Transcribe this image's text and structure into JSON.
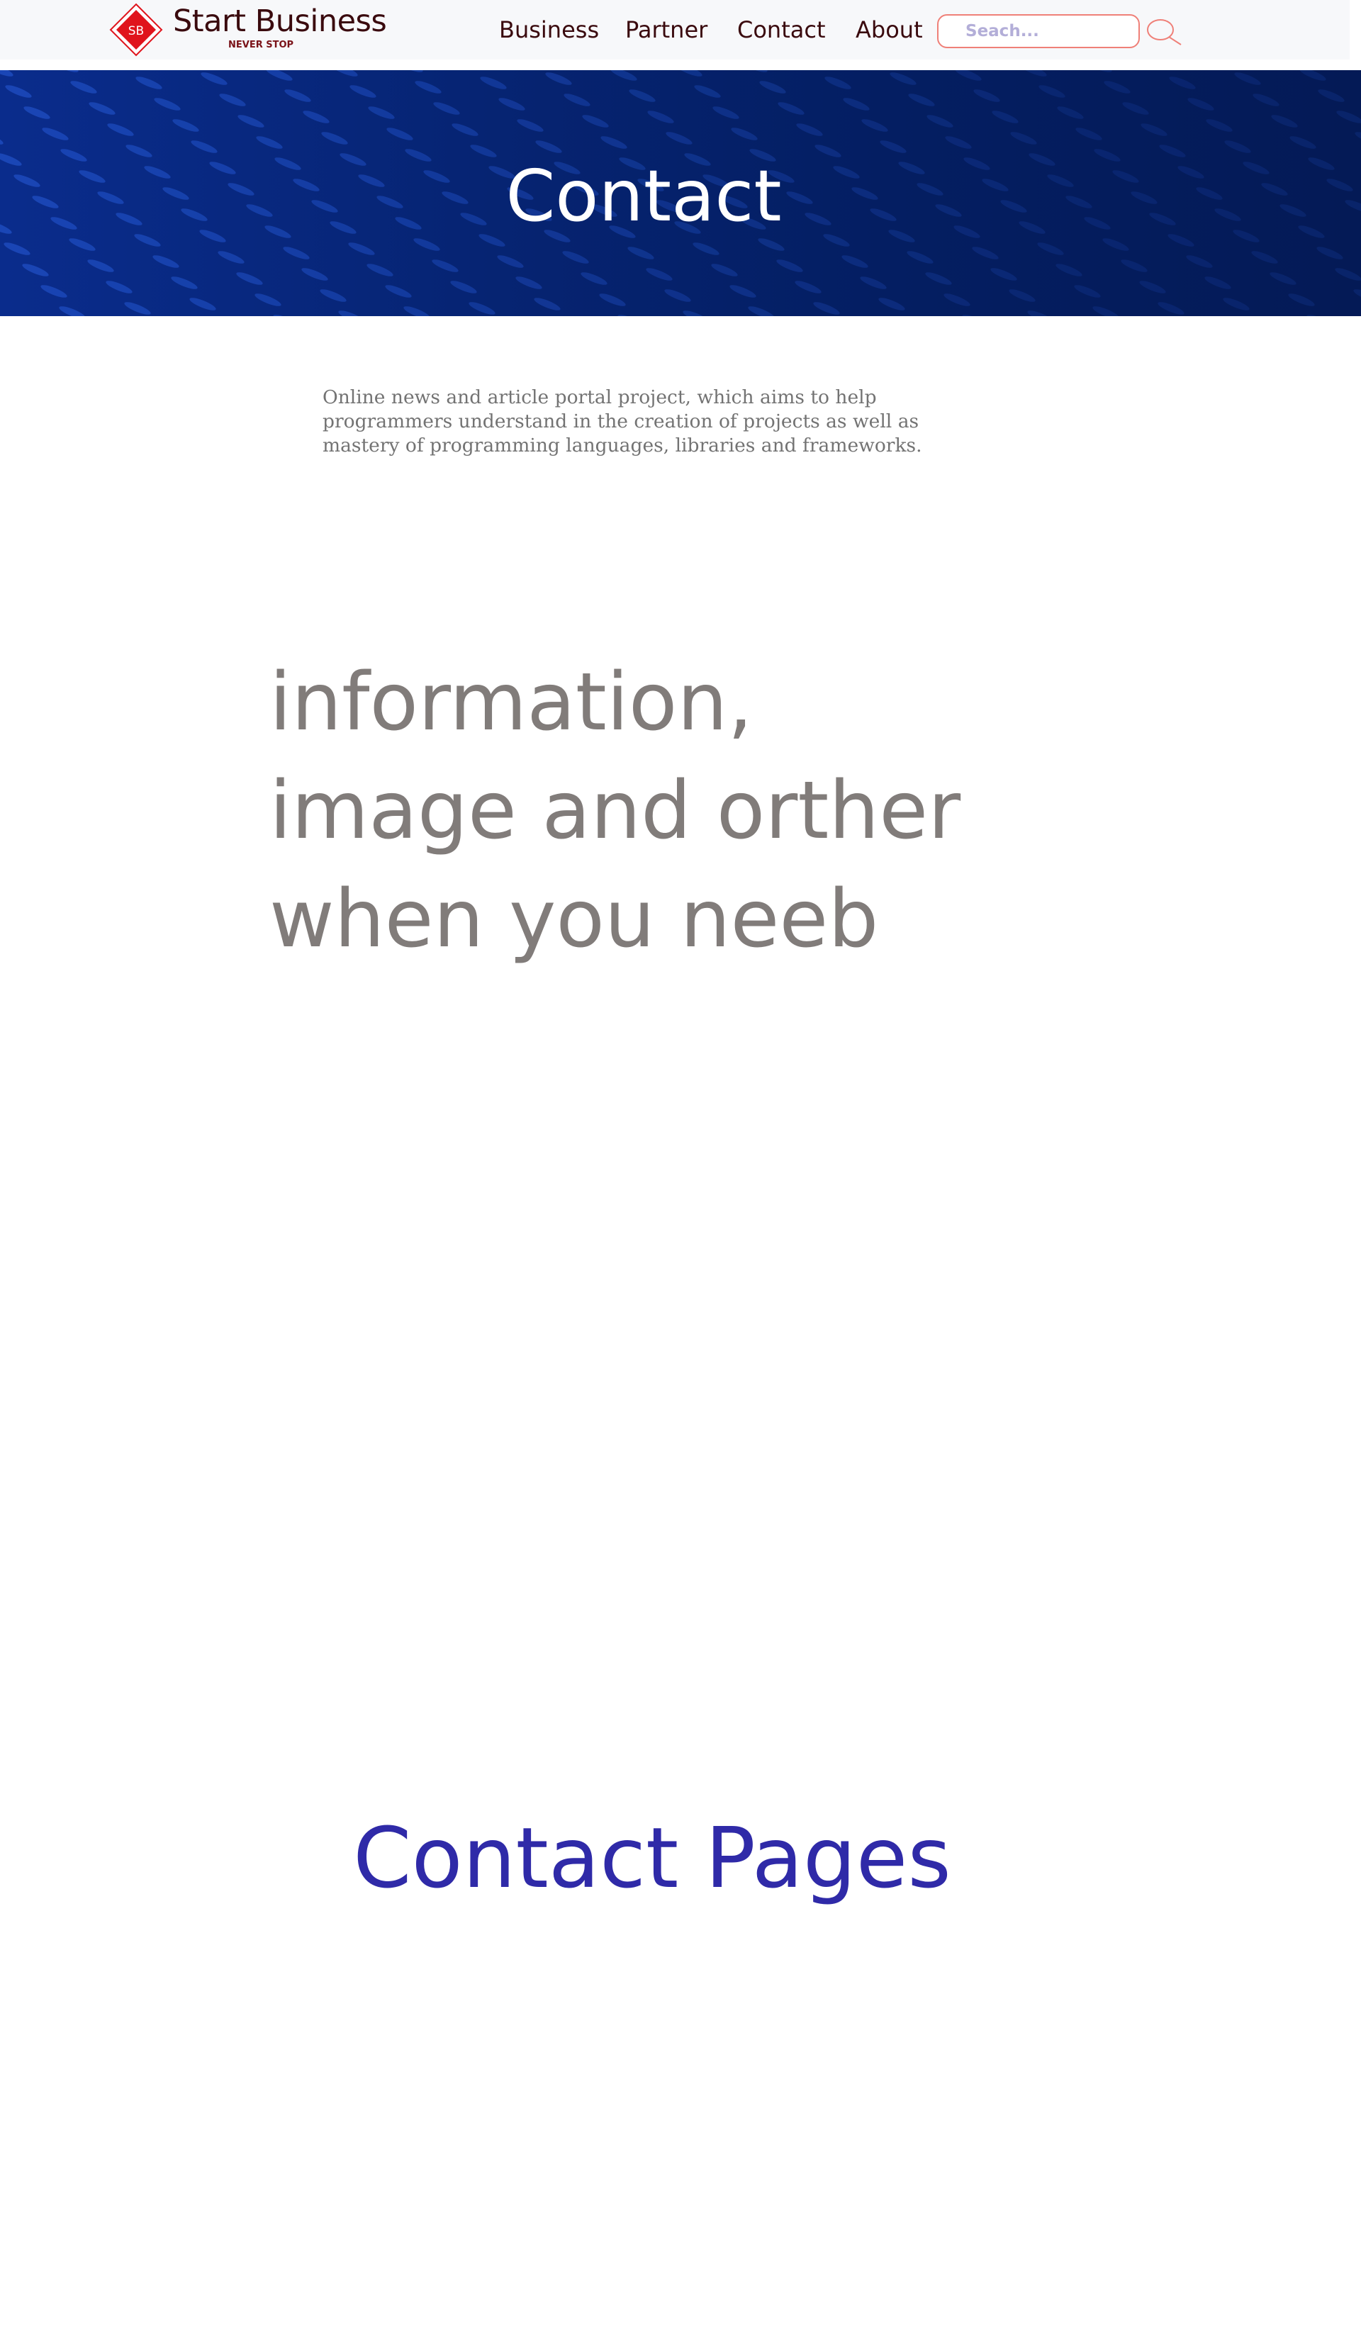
{
  "header": {
    "logo": {
      "mark_text": "SB",
      "title": "Start Business",
      "tagline": "NEVER STOP"
    },
    "nav": [
      {
        "label": "Business"
      },
      {
        "label": "Partner"
      },
      {
        "label": "Contact"
      },
      {
        "label": "About"
      }
    ],
    "search": {
      "placeholder": "Seach...",
      "icon": "search-icon"
    }
  },
  "hero": {
    "title": "Contact"
  },
  "main": {
    "intro": "Online news and article portal project, which aims to help programmers understand in the creation of projects as well as mastery of programming languages, libraries and frameworks.",
    "headline": "information, image and orther when you neeb",
    "contact_pages_title": "Contact Pages"
  },
  "colors": {
    "brand_red": "#e0141c",
    "nav_text": "#3a0a0e",
    "hero_bg": "#062473",
    "headline_gray": "#817c7a",
    "contact_pages_blue": "#2f2aa8",
    "search_border": "#ef8078"
  }
}
